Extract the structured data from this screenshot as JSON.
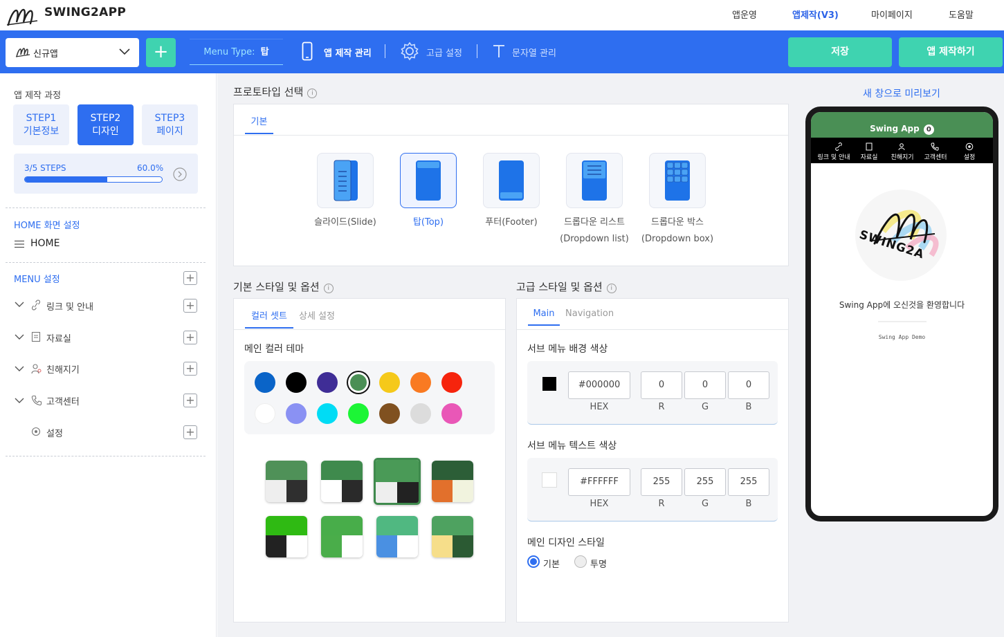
{
  "topnav": {
    "brand": "SWING2APP",
    "links": [
      "앱운영",
      "앱제작(V3)",
      "마이페이지",
      "도움말"
    ]
  },
  "toolbar": {
    "app_select": "신규앱",
    "add_label": "+",
    "menu_type_label": "Menu Type:",
    "menu_type_value": "탑",
    "items": [
      "앱 제작 관리",
      "고급 설정",
      "문자열 관리"
    ],
    "save": "저장",
    "build": "앱 제작하기"
  },
  "sidebar": {
    "process_title": "앱 제작 과정",
    "steps": [
      {
        "line1": "STEP1",
        "line2": "기본정보"
      },
      {
        "line1": "STEP2",
        "line2": "디자인"
      },
      {
        "line1": "STEP3",
        "line2": "페이지"
      }
    ],
    "progress": {
      "steps_text": "3/5 STEPS",
      "percent_text": "60.0%",
      "fraction": 0.6
    },
    "home_section": "HOME 화면 설정",
    "home_item": "HOME",
    "menu_section": "MENU 설정",
    "menu_items": [
      "링크 및 안내",
      "자료실",
      "친해지기",
      "고객센터",
      "설정"
    ]
  },
  "prototype": {
    "title": "프로토타입 선택",
    "tab": "기본",
    "options": [
      {
        "l1": "슬라이드(Slide)",
        "l2": ""
      },
      {
        "l1": "탑(Top)",
        "l2": ""
      },
      {
        "l1": "푸터(Footer)",
        "l2": ""
      },
      {
        "l1": "드롭다운 리스트",
        "l2": "(Dropdown list)"
      },
      {
        "l1": "드롭다운 박스",
        "l2": "(Dropdown box)"
      }
    ],
    "selected_index": 1
  },
  "basic_style": {
    "title": "기본 스타일 및 옵션",
    "tabs": [
      "컬러 셋트",
      "상세 설정"
    ],
    "theme_title": "메인 컬러 테마",
    "colors": [
      "#0a64c8",
      "#000000",
      "#3f2d96",
      "#4a8f55",
      "#f5c91a",
      "#f97a22",
      "#f6240d",
      "#ffffff",
      "#8a91f3",
      "#00dcf5",
      "#1cf536",
      "#805120",
      "#dcdcdc",
      "#e957b7"
    ],
    "selected_color_index": 3
  },
  "advanced_style": {
    "title": "고급 스타일 및 옵션",
    "tabs": [
      "Main",
      "Navigation"
    ],
    "bg_title": "서브 메뉴 배경 색상",
    "bg_hex": "#000000",
    "bg_r": "0",
    "bg_g": "0",
    "bg_b": "0",
    "text_title": "서브 메뉴 텍스트 색상",
    "text_hex": "#FFFFFF",
    "text_r": "255",
    "text_g": "255",
    "text_b": "255",
    "labels": {
      "hex": "HEX",
      "r": "R",
      "g": "G",
      "b": "B"
    },
    "design_title": "메인 디자인 스타일",
    "design_options": [
      "기본",
      "투명"
    ]
  },
  "preview": {
    "link": "새 창으로 미리보기",
    "app_name": "Swing App",
    "badge": "0",
    "menu": [
      "링크 및 안내",
      "자료실",
      "친해지기",
      "고객센터",
      "설정"
    ],
    "logo_text": "SWING2A",
    "welcome": "Swing App에 오신것을 환영합니다",
    "demo": "Swing App Demo"
  },
  "accent_colors": {
    "primary": "#2e6ef0",
    "green": "#3fd3b0",
    "app_green": "#4a8f55"
  }
}
